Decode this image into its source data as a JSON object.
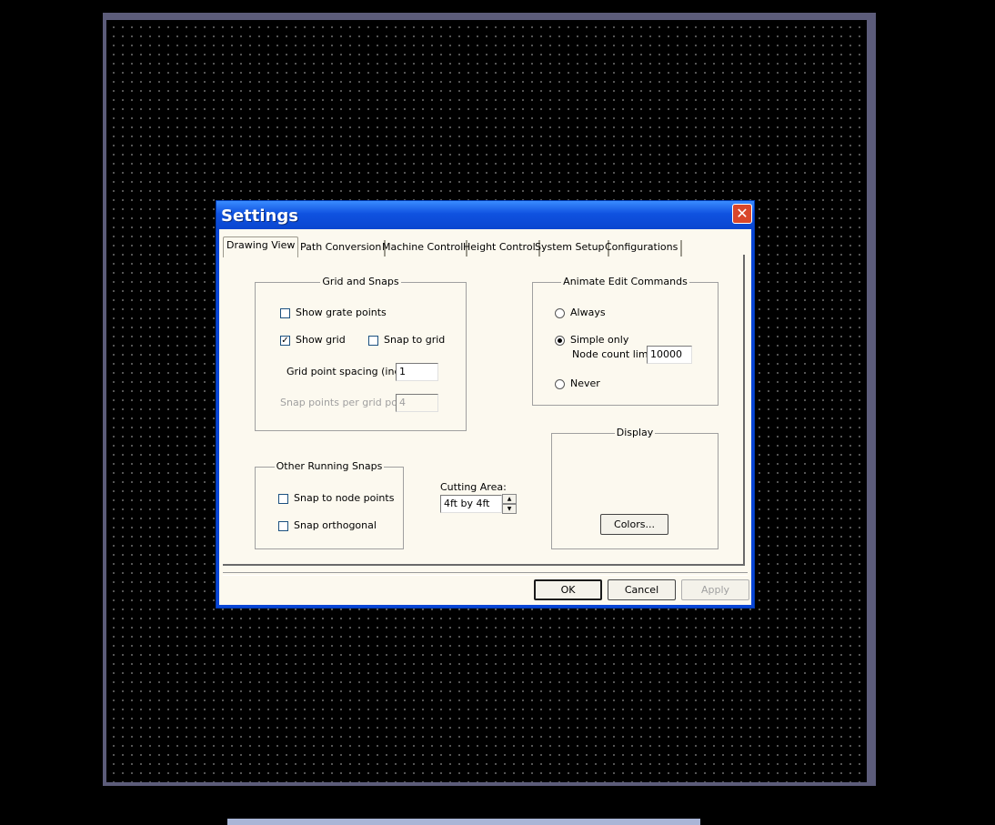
{
  "dialog": {
    "title": "Settings",
    "close_glyph": "✕",
    "tabs": [
      "Drawing View",
      "Path Conversion",
      "Machine Control",
      "Height Control",
      "System Setup",
      "Configurations"
    ],
    "active_tab": "Drawing View"
  },
  "grid_snaps": {
    "title": "Grid and Snaps",
    "show_grate_points": {
      "label": "Show grate points",
      "checked": false
    },
    "show_grid": {
      "label": "Show grid",
      "checked": true
    },
    "snap_to_grid": {
      "label": "Snap to grid",
      "checked": false
    },
    "spacing_label": "Grid point spacing (inch):",
    "spacing_value": "1",
    "snap_points_label": "Snap points per grid point:",
    "snap_points_value": "4"
  },
  "animate": {
    "title": "Animate Edit Commands",
    "always": "Always",
    "simple_only": "Simple only",
    "node_count_label": "Node count limit:",
    "node_count_value": "10000",
    "never": "Never",
    "selected": "Simple only"
  },
  "other_snaps": {
    "title": "Other Running Snaps",
    "node_points": {
      "label": "Snap to node points",
      "checked": false
    },
    "orthogonal": {
      "label": "Snap orthogonal",
      "checked": false
    }
  },
  "cutting_area": {
    "label": "Cutting Area:",
    "value": "4ft by 4ft"
  },
  "display": {
    "title": "Display",
    "colors_button": "Colors..."
  },
  "buttons": {
    "ok": "OK",
    "cancel": "Cancel",
    "apply": "Apply"
  },
  "colors": {
    "titlebar": "#0a46d6",
    "client_bg": "#fcf9ef",
    "close_bg": "#d9472a",
    "canvas_frame": "#5c5c7a"
  }
}
